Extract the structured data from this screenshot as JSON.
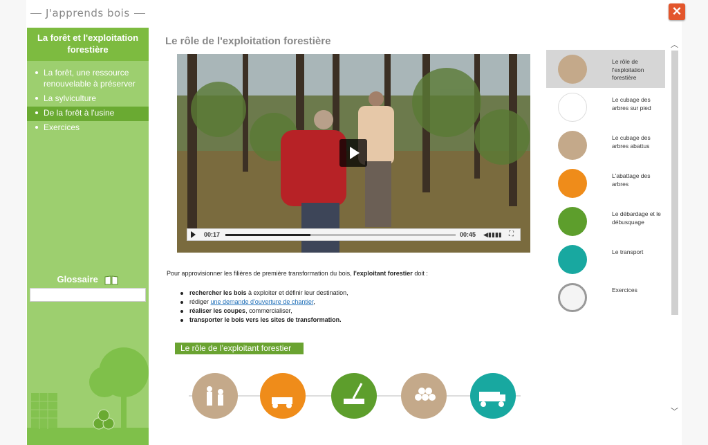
{
  "app": {
    "title": "J'apprends bois",
    "close_label": "✕"
  },
  "sidebar": {
    "heading": "La forêt et l'exploitation forestière",
    "items": [
      {
        "label": "La forêt, une ressource renouvelable à préserver",
        "active": false
      },
      {
        "label": "La sylviculture",
        "active": false
      },
      {
        "label": "De la forêt à l'usine",
        "active": true
      },
      {
        "label": "Exercices",
        "active": false
      }
    ],
    "glossary_label": "Glossaire",
    "glossary_placeholder": ""
  },
  "main": {
    "title": "Le rôle de l'exploitation forestière",
    "video": {
      "current_time": "00:17",
      "duration": "00:45",
      "progress": 0.37
    },
    "intro_prefix": "Pour approvisionner les filières de première transformation du bois, ",
    "intro_bold": "l'exploitant forestier",
    "intro_suffix": " doit :",
    "bullets": [
      {
        "bold": "rechercher les bois",
        "text": " à exploiter et définir leur destination,"
      },
      {
        "prefix": "rédiger ",
        "link": "une demande d'ouverture de chantier",
        "suffix": ","
      },
      {
        "bold": "réaliser les coupes",
        "text": ", commercialiser,"
      },
      {
        "bold": "transporter le bois vers les sites de transformation.",
        "text": ""
      }
    ],
    "infographic_title": "Le rôle de l’exploitant forestier"
  },
  "nav": {
    "items": [
      {
        "label": "Le rôle de l'exploitation forestière",
        "icon": "forest-workers-icon",
        "color": "#c4a98a",
        "active": true
      },
      {
        "label": "Le cubage des arbres sur pied",
        "icon": "tree-measure-icon",
        "color": "#ffffff",
        "active": false
      },
      {
        "label": "Le cubage des arbres abattus",
        "icon": "log-pile-icon",
        "color": "#c4a98a",
        "active": false
      },
      {
        "label": "L'abattage des arbres",
        "icon": "felling-machine-icon",
        "color": "#ef8c1a",
        "active": false
      },
      {
        "label": "Le débardage et le débusquage",
        "icon": "skidder-icon",
        "color": "#5d9e2c",
        "active": false
      },
      {
        "label": "Le transport",
        "icon": "truck-icon",
        "color": "#18a8a0",
        "active": false
      },
      {
        "label": "Exercices",
        "icon": "stopwatch-icon",
        "color": "#dddddd",
        "active": false
      }
    ]
  },
  "colors": {
    "sidebar": "#9dcf6f",
    "sidebar_head": "#7dbb40",
    "close": "#e3562c",
    "infographic_bar": "#6aa331"
  }
}
